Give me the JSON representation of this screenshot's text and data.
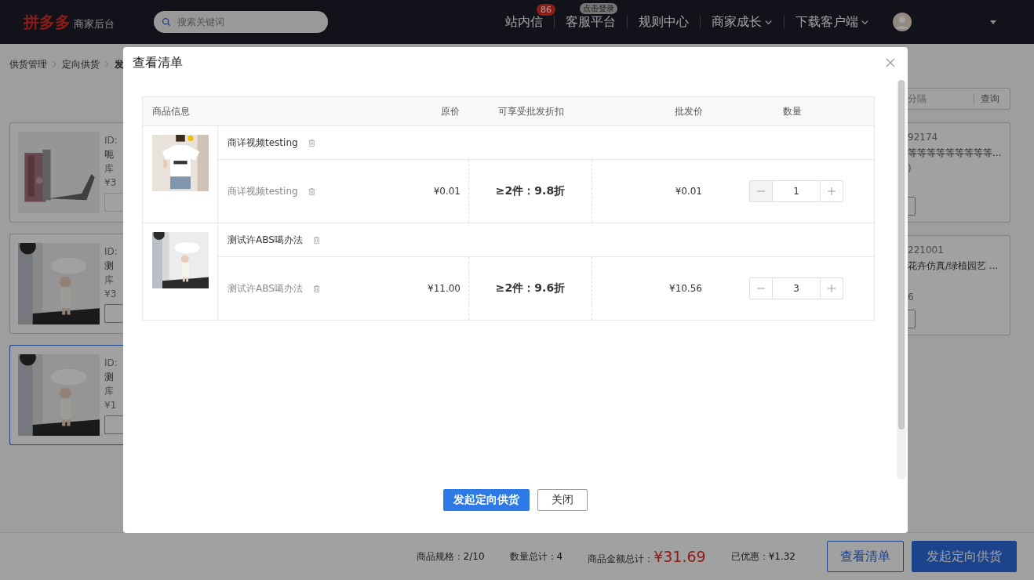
{
  "header": {
    "logo": "拼多多",
    "subtitle": "商家后台",
    "search": {
      "placeholder": "搜索关键词"
    },
    "nav": [
      {
        "label": "站内信",
        "badge": {
          "text": "86",
          "kind": "count"
        },
        "dropdown": false
      },
      {
        "label": "客服平台",
        "badge": {
          "text": "点击登录",
          "kind": "tag"
        },
        "dropdown": false
      },
      {
        "label": "规则中心",
        "dropdown": false
      },
      {
        "label": "商家成长",
        "dropdown": true
      },
      {
        "label": "下载客户端",
        "dropdown": true
      }
    ]
  },
  "breadcrumb": [
    "供货管理",
    "定向供货",
    "发"
  ],
  "left_cards": [
    {
      "id": "ID:",
      "name": "呃",
      "stock": "库",
      "price": "¥3",
      "disabled": true,
      "selected": false
    },
    {
      "id": "ID:",
      "name": "测",
      "stock": "库",
      "price": "¥3",
      "disabled": false,
      "selected": false
    },
    {
      "id": "ID:",
      "name": "测",
      "stock": "库",
      "price": "¥1",
      "disabled": false,
      "selected": true
    }
  ],
  "right_search": {
    "placeholder": "分隔",
    "button": "查询"
  },
  "right_cards": [
    {
      "id": "92174",
      "name": "等等等等等等等等等...",
      "stock": ")"
    },
    {
      "id": "221001",
      "name": "花卉仿真/绿植园艺 ...",
      "price": "6"
    }
  ],
  "modal": {
    "title": "查看清单",
    "columns": [
      "商品信息",
      "原价",
      "可享受批发折扣",
      "批发价",
      "数量"
    ],
    "products": [
      {
        "title": "商详视频testing",
        "skus": [
          {
            "name": "商详视频testing",
            "price": "¥0.01",
            "discount": "≥2件：9.8折",
            "wholesale": "¥0.01",
            "quantity": "1",
            "minus_disabled": true
          }
        ]
      },
      {
        "title": "测试许ABS噶办法",
        "skus": [
          {
            "name": "测试许ABS噶办法",
            "price": "¥11.00",
            "discount": "≥2件：9.6折",
            "wholesale": "¥10.56",
            "quantity": "3",
            "minus_disabled": false
          }
        ]
      }
    ],
    "buttons": [
      {
        "label": "发起定向供货",
        "kind": "primary"
      },
      {
        "label": "关闭",
        "kind": "default"
      }
    ]
  },
  "footer": {
    "stats": [
      {
        "label": "商品规格：",
        "value": "2/10",
        "kind": "plain"
      },
      {
        "label": "数量总计：",
        "value": "4",
        "kind": "plain"
      },
      {
        "label": "商品金额总计：",
        "value": "¥31.69",
        "kind": "total"
      },
      {
        "label": "已优惠：",
        "value": "¥1.32",
        "kind": "plain"
      }
    ],
    "buttons": [
      {
        "label": "查看清单",
        "kind": "default"
      },
      {
        "label": "发起定向供货",
        "kind": "primary"
      }
    ]
  }
}
